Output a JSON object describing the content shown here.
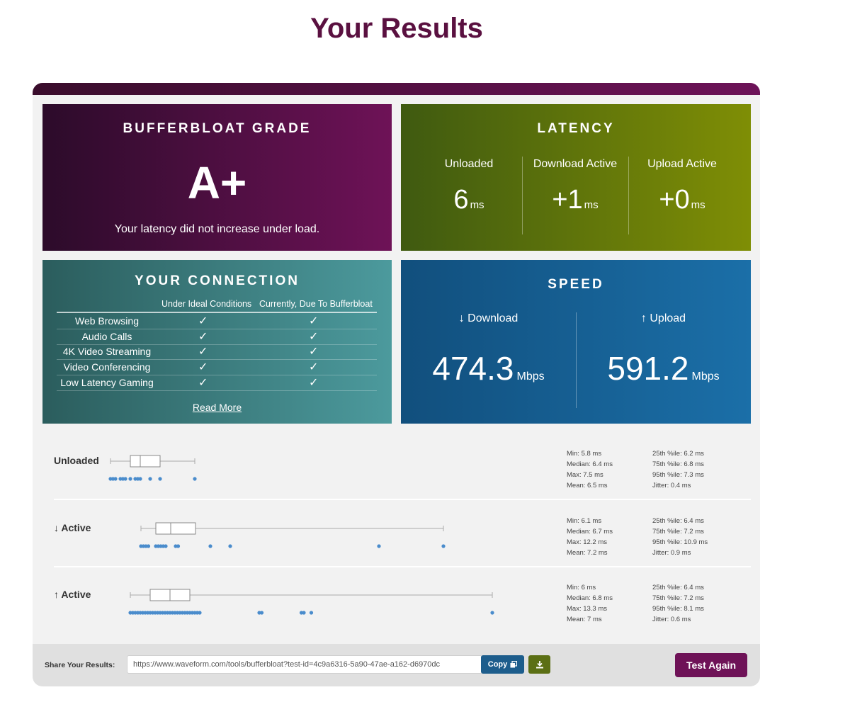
{
  "title": "Your Results",
  "grade": {
    "title": "BUFFERBLOAT GRADE",
    "value": "A+",
    "description": "Your latency did not increase under load."
  },
  "latency": {
    "title": "LATENCY",
    "unit": "ms",
    "columns": [
      {
        "label": "Unloaded",
        "value": "6"
      },
      {
        "label": "Download Active",
        "value": "+1"
      },
      {
        "label": "Upload Active",
        "value": "+0"
      }
    ]
  },
  "connection": {
    "title": "YOUR CONNECTION",
    "headers": [
      "Under Ideal Conditions",
      "Currently, Due To Bufferbloat"
    ],
    "rows": [
      {
        "name": "Web Browsing",
        "ideal": "✓",
        "current": "✓"
      },
      {
        "name": "Audio Calls",
        "ideal": "✓",
        "current": "✓"
      },
      {
        "name": "4K Video Streaming",
        "ideal": "✓",
        "current": "✓"
      },
      {
        "name": "Video Conferencing",
        "ideal": "✓",
        "current": "✓"
      },
      {
        "name": "Low Latency Gaming",
        "ideal": "✓",
        "current": "✓"
      }
    ],
    "read_more": "Read More"
  },
  "speed": {
    "title": "SPEED",
    "unit": "Mbps",
    "download": {
      "label": "↓ Download",
      "value": "474.3"
    },
    "upload": {
      "label": "↑ Upload",
      "value": "591.2"
    }
  },
  "stats": [
    {
      "label": "Unloaded",
      "left": [
        "Min: 5.8 ms",
        "Median: 6.4 ms",
        "Max: 7.5 ms",
        "Mean: 6.5 ms"
      ],
      "right": [
        "25th %ile: 6.2 ms",
        "75th %ile: 6.8 ms",
        "95th %ile: 7.3 ms",
        "Jitter: 0.4 ms"
      ],
      "min": 5.8,
      "q1": 6.2,
      "median": 6.4,
      "q3": 6.8,
      "max": 7.5,
      "samples": [
        5.8,
        5.85,
        5.9,
        6.0,
        6.05,
        6.1,
        6.2,
        6.3,
        6.35,
        6.4,
        6.6,
        6.8,
        7.5
      ]
    },
    {
      "label": "↓ Active",
      "left": [
        "Min: 6.1 ms",
        "Median: 6.7 ms",
        "Max: 12.2 ms",
        "Mean: 7.2 ms"
      ],
      "right": [
        "25th %ile: 6.4 ms",
        "75th %ile: 7.2 ms",
        "95th %ile: 10.9 ms",
        "Jitter: 0.9 ms"
      ],
      "min": 6.1,
      "q1": 6.4,
      "median": 6.7,
      "q3": 7.2,
      "max": 12.2,
      "samples": [
        6.1,
        6.15,
        6.2,
        6.25,
        6.4,
        6.45,
        6.5,
        6.55,
        6.6,
        6.8,
        6.85,
        7.5,
        7.9,
        10.9,
        12.2
      ]
    },
    {
      "label": "↑ Active",
      "left": [
        "Min: 6 ms",
        "Median: 6.8 ms",
        "Max: 13.3 ms",
        "Mean: 7 ms"
      ],
      "right": [
        "25th %ile: 6.4 ms",
        "75th %ile: 7.2 ms",
        "95th %ile: 8.1 ms",
        "Jitter: 0.6 ms"
      ],
      "min": 6.0,
      "q1": 6.4,
      "median": 6.8,
      "q3": 7.2,
      "max": 13.3,
      "samples": [
        6.0,
        6.05,
        6.1,
        6.15,
        6.2,
        6.25,
        6.3,
        6.35,
        6.4,
        6.45,
        6.5,
        6.55,
        6.6,
        6.65,
        6.7,
        6.75,
        6.8,
        6.85,
        6.9,
        6.95,
        7.0,
        7.05,
        7.1,
        7.15,
        7.2,
        7.25,
        7.3,
        7.35,
        7.4,
        8.6,
        8.65,
        9.45,
        9.5,
        9.65,
        13.3
      ]
    }
  ],
  "plot_scale": {
    "min": 5.5,
    "max": 13.5
  },
  "share": {
    "label": "Share Your Results:",
    "url": "https://www.waveform.com/tools/bufferbloat?test-id=4c9a6316-5a90-47ae-a162-d6970dc",
    "copy_label": "Copy",
    "test_again_label": "Test Again"
  },
  "colors": {
    "grade_bg": "#6e1257",
    "latency_bg": "#7f8e05",
    "connection_bg": "#4c9a9d",
    "speed_bg": "#1b6fa8",
    "sample_dot": "#4a8ccc"
  },
  "icons": [
    "check-icon",
    "copy-icon",
    "download-icon"
  ]
}
